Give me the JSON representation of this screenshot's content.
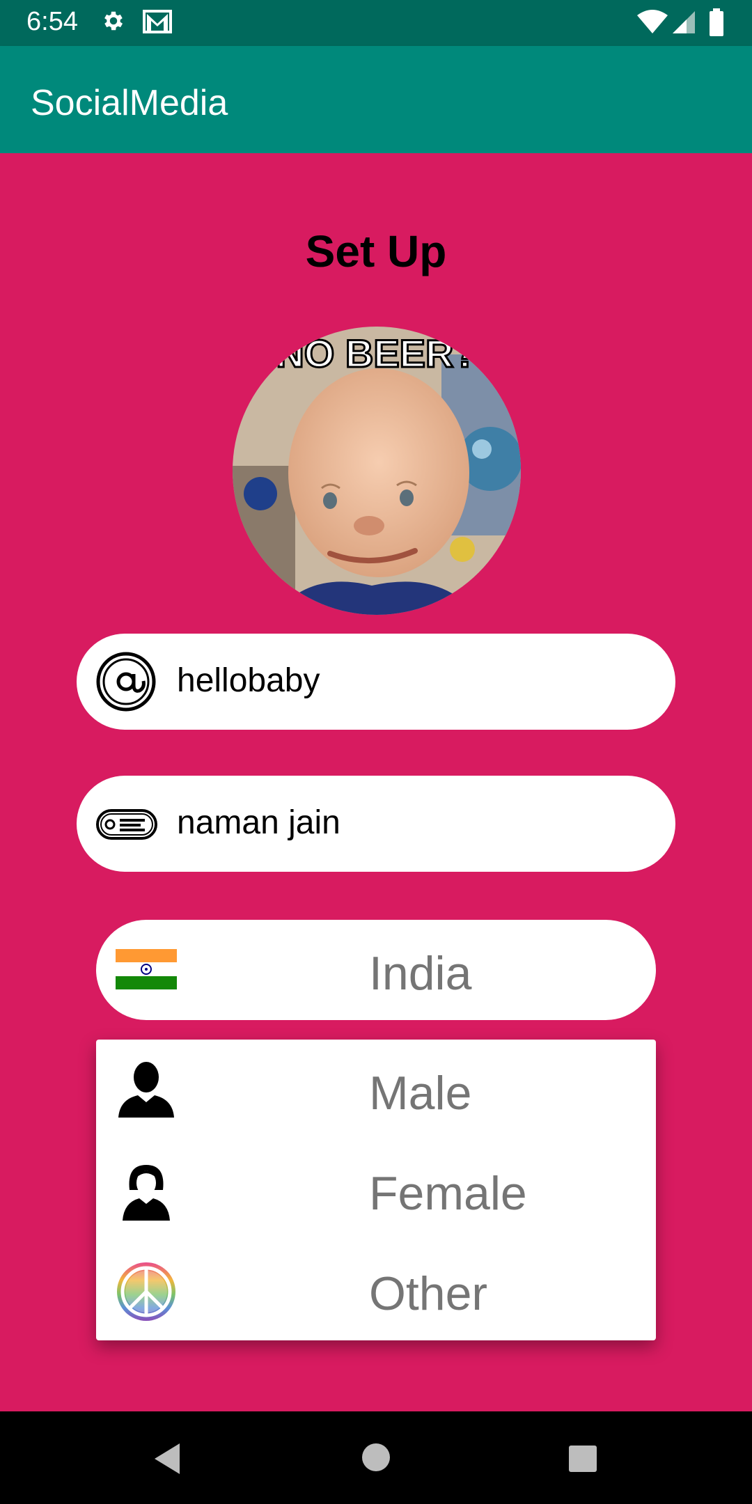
{
  "status_bar": {
    "time": "6:54",
    "icons": [
      "gear-icon",
      "gmail-icon",
      "wifi-icon",
      "signal-icon",
      "battery-icon"
    ]
  },
  "app_bar": {
    "title": "SocialMedia"
  },
  "page": {
    "title": "Set Up"
  },
  "avatar": {
    "caption": "NO BEER?"
  },
  "fields": {
    "username": {
      "value": "hellobaby",
      "icon": "at-sign-icon"
    },
    "name": {
      "value": "naman jain",
      "icon": "name-tag-icon"
    }
  },
  "country_spinner": {
    "selected": "India",
    "icon": "india-flag-icon"
  },
  "gender_dropdown": {
    "options": [
      {
        "label": "Male",
        "icon": "male-silhouette-icon"
      },
      {
        "label": "Female",
        "icon": "female-silhouette-icon"
      },
      {
        "label": "Other",
        "icon": "peace-sign-icon"
      }
    ]
  },
  "colors": {
    "status_bar": "#00695c",
    "app_bar": "#00897b",
    "background": "#d81b60",
    "field_bg": "#ffffff",
    "option_text": "#757575"
  },
  "nav_bar": {
    "icons": [
      "back-icon",
      "home-icon",
      "recents-icon"
    ]
  }
}
